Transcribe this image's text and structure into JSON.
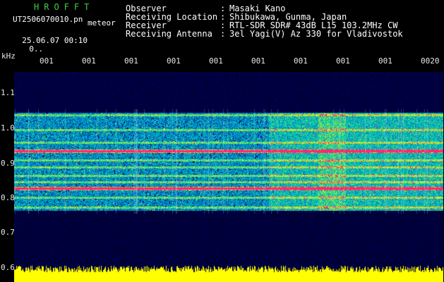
{
  "header": {
    "app_title": "HROFFT",
    "filename": "UT2506070010.pn",
    "mode": "meteor",
    "date_time": "25.06.07 00:10",
    "counter": "0.."
  },
  "station_info": [
    {
      "label": "Observer",
      "value": "Masaki Kano"
    },
    {
      "label": "Receiving Location",
      "value": "Shibukawa, Gunma, Japan"
    },
    {
      "label": "Receiver",
      "value": "RTL-SDR SDR# 43dB L15 103.2MHz CW"
    },
    {
      "label": "Receiving Antenna",
      "value": "3el Yagi(V) Az 330 for Vladivostok"
    }
  ],
  "axis": {
    "y_unit": "kHz",
    "y_ticks": [
      "1.1",
      "1.0",
      "0.9",
      "0.8",
      "0.7",
      "0.6"
    ],
    "x_ticks": [
      "001",
      "001",
      "001",
      "001",
      "001",
      "001",
      "001",
      "001",
      "001",
      "0020"
    ]
  },
  "colors": {
    "title_green": "#3fd23f",
    "waterfall_background": "#000020",
    "noise_floor": "#ffff00",
    "signal_red": "#ff2060"
  }
}
